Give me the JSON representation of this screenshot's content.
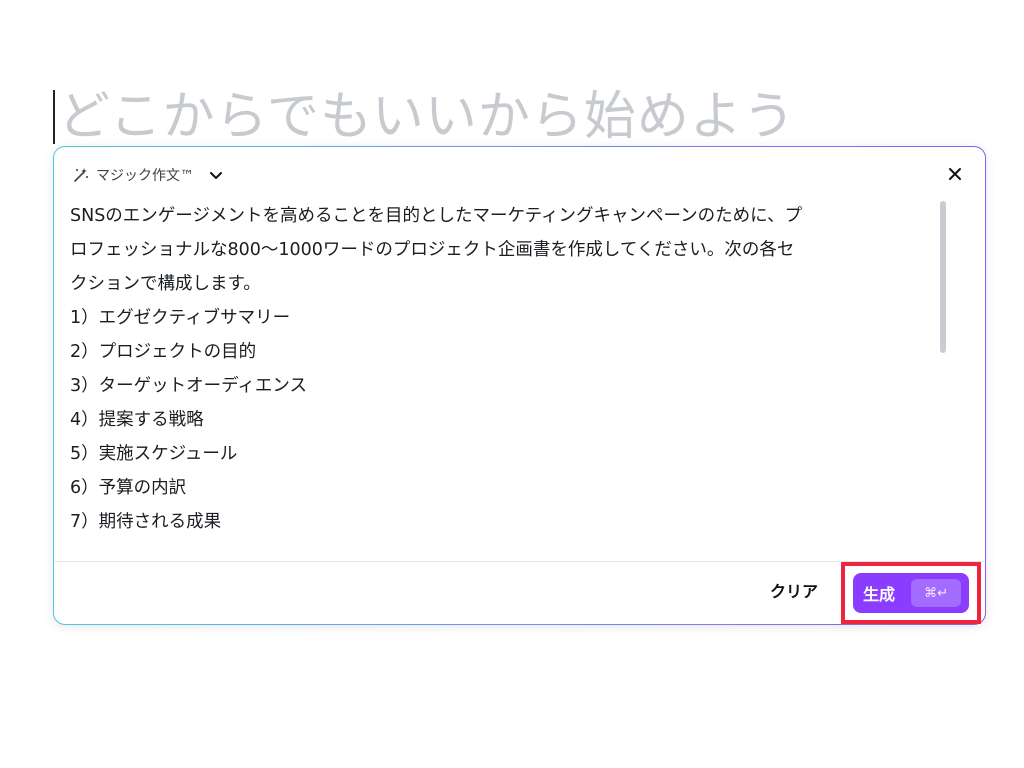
{
  "editor": {
    "placeholder": "どこからでもいいから始めよう"
  },
  "panel": {
    "title": "マジック作文™",
    "icons": {
      "title_icon": "magic-wand-icon",
      "dropdown_icon": "chevron-down-icon",
      "close_icon": "close-icon",
      "enter_icon": "return-icon"
    },
    "prompt_lines": [
      "SNSのエンゲージメントを高めることを目的としたマーケティングキャンペーンのために、プ",
      "ロフェッショナルな800〜1000ワードのプロジェクト企画書を作成してください。次の各セ",
      "クションで構成します。",
      "1）エグゼクティブサマリー",
      "2）プロジェクトの目的",
      "3）ターゲットオーディエンス",
      "4）提案する戦略",
      "5）実施スケジュール",
      "6）予算の内訳",
      "7）期待される成果"
    ],
    "clear_label": "クリア",
    "generate_label": "生成",
    "shortcut_label": "⌘↵"
  },
  "colors": {
    "accent": "#8b3dff",
    "highlight": "#f0243c"
  }
}
